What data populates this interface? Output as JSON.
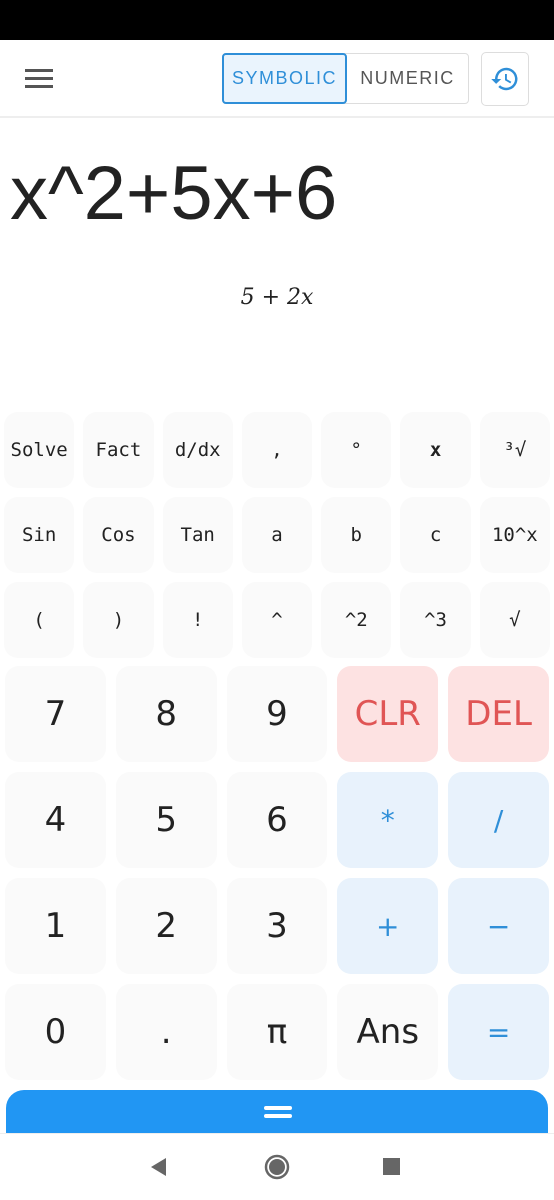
{
  "header": {
    "mode_symbolic": "SYMBOLIC",
    "mode_numeric": "NUMERIC",
    "active_mode": "SYMBOLIC",
    "history_icon": "history-icon",
    "menu_icon": "hamburger-menu-icon"
  },
  "display": {
    "expression": "x^2+5x+6",
    "result": "5 + 2x"
  },
  "small_keys": [
    "Solve",
    "Fact",
    "d/dx",
    ",",
    "°",
    "x",
    "³√",
    "Sin",
    "Cos",
    "Tan",
    "a",
    "b",
    "c",
    "10^x",
    "(",
    ")",
    "!",
    "^",
    "^2",
    "^3",
    "√"
  ],
  "big_keys": [
    {
      "label": "7",
      "kind": "num"
    },
    {
      "label": "8",
      "kind": "num"
    },
    {
      "label": "9",
      "kind": "num"
    },
    {
      "label": "CLR",
      "kind": "danger"
    },
    {
      "label": "DEL",
      "kind": "danger"
    },
    {
      "label": "4",
      "kind": "num"
    },
    {
      "label": "5",
      "kind": "num"
    },
    {
      "label": "6",
      "kind": "num"
    },
    {
      "label": "*",
      "kind": "op"
    },
    {
      "label": "/",
      "kind": "op"
    },
    {
      "label": "1",
      "kind": "num"
    },
    {
      "label": "2",
      "kind": "num"
    },
    {
      "label": "3",
      "kind": "num"
    },
    {
      "label": "+",
      "kind": "op"
    },
    {
      "label": "−",
      "kind": "op"
    },
    {
      "label": "0",
      "kind": "num"
    },
    {
      "label": ".",
      "kind": "num"
    },
    {
      "label": "π",
      "kind": "num"
    },
    {
      "label": "Ans",
      "kind": "num"
    },
    {
      "label": "=",
      "kind": "op"
    }
  ],
  "colors": {
    "accent": "#2196f3",
    "danger": "#e05555",
    "danger_bg": "#fde2e2",
    "op_bg": "#e8f2fc"
  }
}
